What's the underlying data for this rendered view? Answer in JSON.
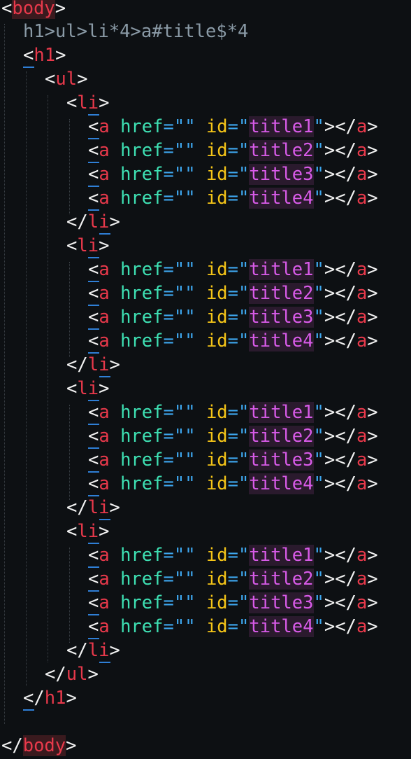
{
  "editor": {
    "body_open_tag": "body",
    "emmet_abbreviation": "h1>ul>li*4>a#title$*4",
    "h1_tag": "h1",
    "ul_tag": "ul",
    "li_tag": "li",
    "a_tag": "a",
    "href_attr": "href",
    "href_value": "\"\"",
    "id_attr": "id",
    "ids": [
      "title1",
      "title2",
      "title3",
      "title4"
    ],
    "body_close_tag": "body"
  },
  "colors": {
    "background": "#0d1013",
    "tag": "#e8394b",
    "href_attribute": "#3ee0b3",
    "id_attribute": "#f5c518",
    "string_value": "#d85be8",
    "punctuation": "#3ea8f0"
  }
}
